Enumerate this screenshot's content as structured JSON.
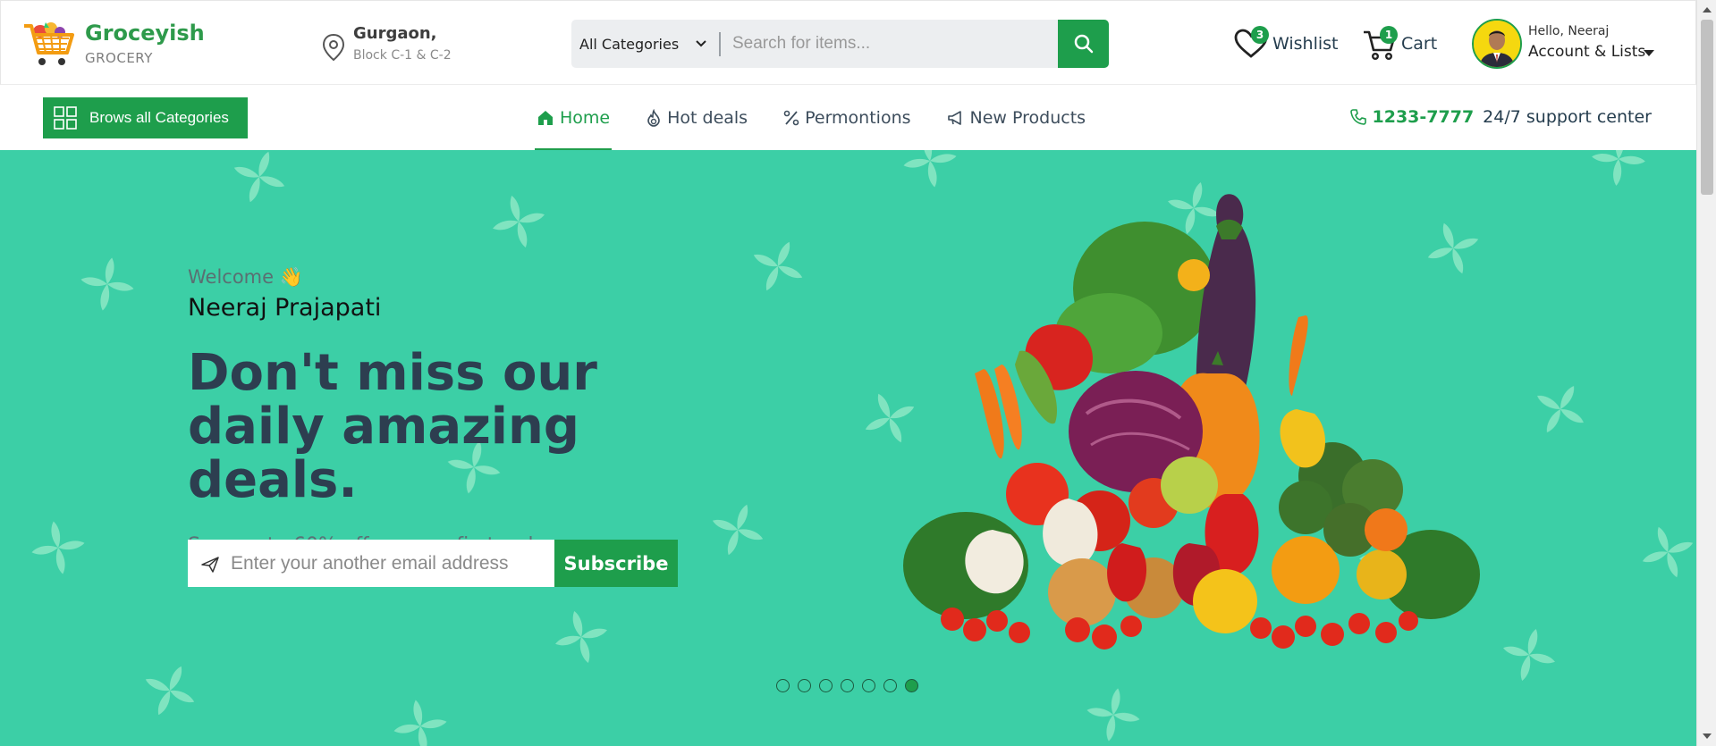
{
  "brand": {
    "name": "Groceyish",
    "tagline": "GROCERY",
    "accent": "#1e9e4c",
    "hero_bg": "#3ccfa6"
  },
  "location": {
    "city": "Gurgaon,",
    "block": "Block C-1 & C-2",
    "icon": "map-pin-icon"
  },
  "search": {
    "category": "All Categories",
    "placeholder": "Search for items...",
    "icon": "search-icon"
  },
  "wishlist": {
    "label": "Wishlist",
    "count": "3",
    "icon": "heart-icon"
  },
  "cart": {
    "label": "Cart",
    "count": "1",
    "icon": "cart-icon"
  },
  "account": {
    "greeting": "Hello, Neeraj",
    "label": "Account & Lists"
  },
  "nav": {
    "browse": "Brows all Categories",
    "links": [
      {
        "label": "Home",
        "icon": "home-icon",
        "active": true
      },
      {
        "label": "Hot deals",
        "icon": "flame-icon",
        "active": false
      },
      {
        "label": "Permontions",
        "icon": "percent-icon",
        "active": false
      },
      {
        "label": "New Products",
        "icon": "megaphone-icon",
        "active": false
      }
    ],
    "phone": "1233-7777",
    "support": "24/7 support center"
  },
  "hero": {
    "welcome": "Welcome  👋",
    "user_name": "Neeraj Prajapati",
    "headline": "Don't miss our daily amazing deals.",
    "subtext": "Save upto 60% off on your first order",
    "email_placeholder": "Enter your another email address",
    "subscribe_label": "Subscribe",
    "slides": 7,
    "active_slide": 7
  }
}
